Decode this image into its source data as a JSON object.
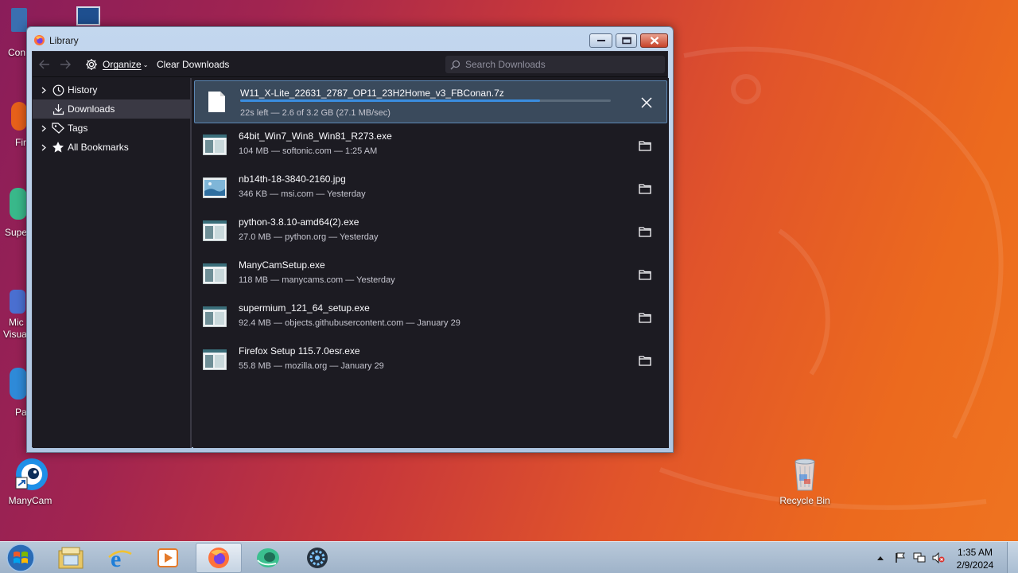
{
  "desktop": {
    "icons": [
      {
        "label": "ManyCam"
      },
      {
        "label": "Recycle Bin"
      }
    ],
    "partial_labels": [
      "Con",
      "Fir",
      "Supe",
      "Mic",
      "Visua",
      "Pa"
    ]
  },
  "window": {
    "title": "Library",
    "toolbar": {
      "organize_label": "Organize",
      "clear_label": "Clear Downloads",
      "search_placeholder": "Search Downloads"
    },
    "sidebar": {
      "items": [
        {
          "label": "History",
          "icon": "clock-icon"
        },
        {
          "label": "Downloads",
          "icon": "download-icon",
          "selected": true
        },
        {
          "label": "Tags",
          "icon": "tag-icon"
        },
        {
          "label": "All Bookmarks",
          "icon": "star-icon"
        }
      ]
    },
    "downloads": [
      {
        "name": "W11_X-Lite_22631_2787_OP11_23H2Home_v3_FBConan.7z",
        "status": "22s left — 2.6 of 3.2 GB (27.1 MB/sec)",
        "active": true,
        "progress": 0.81,
        "file_icon": "blank-file-icon"
      },
      {
        "name": "64bit_Win7_Win8_Win81_R273.exe",
        "status": "104 MB — softonic.com — 1:25 AM",
        "file_icon": "exe-file-icon"
      },
      {
        "name": "nb14th-18-3840-2160.jpg",
        "status": "346 KB — msi.com — Yesterday",
        "file_icon": "image-file-icon"
      },
      {
        "name": "python-3.8.10-amd64(2).exe",
        "status": "27.0 MB — python.org — Yesterday",
        "file_icon": "exe-file-icon"
      },
      {
        "name": "ManyCamSetup.exe",
        "status": "118 MB — manycams.com — Yesterday",
        "file_icon": "exe-file-icon"
      },
      {
        "name": "supermium_121_64_setup.exe",
        "status": "92.4 MB — objects.githubusercontent.com — January 29",
        "file_icon": "exe-file-icon"
      },
      {
        "name": "Firefox Setup 115.7.0esr.exe",
        "status": "55.8 MB — mozilla.org — January 29",
        "file_icon": "exe-file-icon"
      }
    ]
  },
  "taskbar": {
    "apps": [
      "file-explorer-icon",
      "internet-explorer-icon",
      "media-player-icon",
      "firefox-icon",
      "supermium-icon",
      "settings-app-icon"
    ],
    "clock": {
      "time": "1:35 AM",
      "date": "2/9/2024"
    }
  },
  "colors": {
    "progress": "#3a8de0",
    "panel_bg": "#1c1b22",
    "selection": "#3a3944"
  }
}
